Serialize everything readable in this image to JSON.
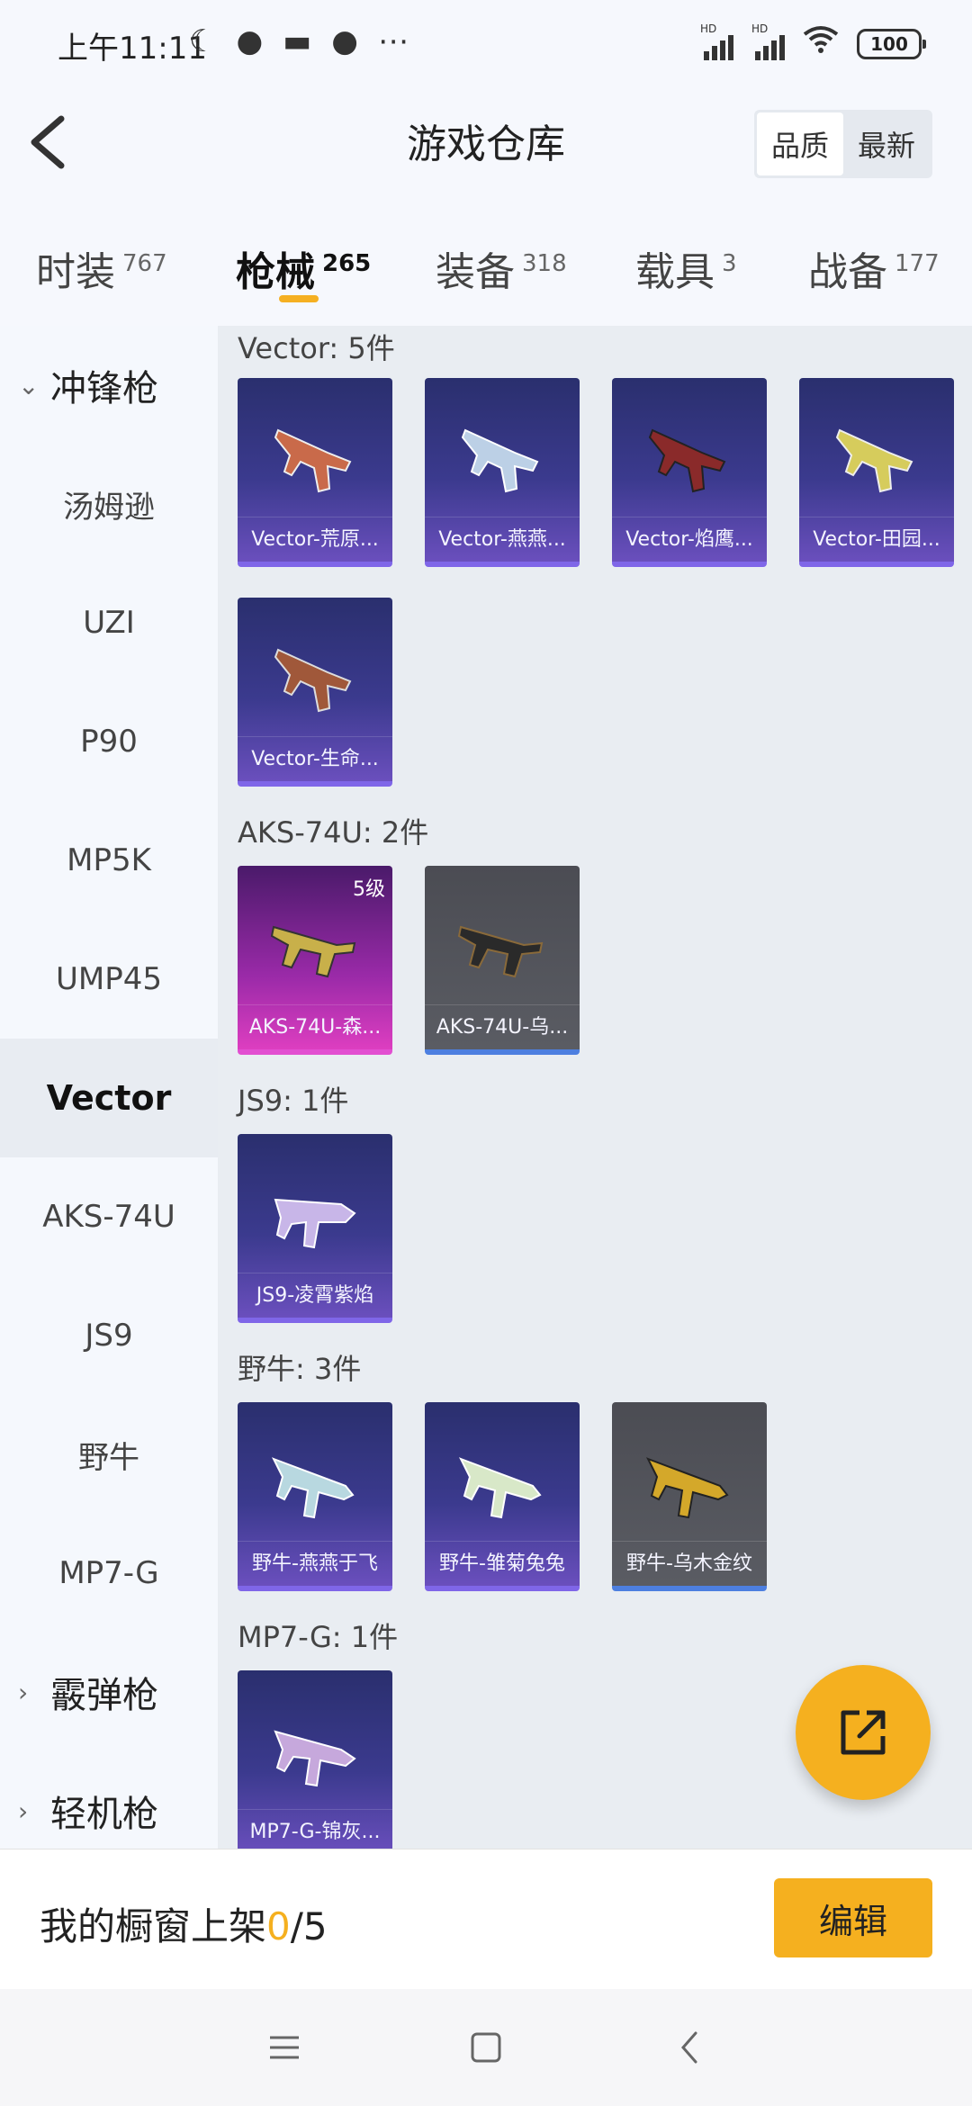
{
  "status_bar": {
    "time": "上午11:11",
    "icons": [
      "moon-icon",
      "wechat-icon",
      "message-icon",
      "wechat-icon",
      "more-icon"
    ],
    "signal_labels": [
      "HD",
      "HD"
    ],
    "battery": "100"
  },
  "header": {
    "title": "游戏仓库",
    "sort_options": [
      "品质",
      "最新"
    ],
    "sort_active": "品质"
  },
  "tabs": [
    {
      "label": "时装",
      "count": "767"
    },
    {
      "label": "枪械",
      "count": "265"
    },
    {
      "label": "装备",
      "count": "318"
    },
    {
      "label": "载具",
      "count": "3"
    },
    {
      "label": "战备",
      "count": "177"
    }
  ],
  "active_tab": "枪械",
  "sidebar": {
    "items": [
      {
        "label": "冲锋枪",
        "type": "category",
        "expanded": true
      },
      {
        "label": "汤姆逊"
      },
      {
        "label": "UZI"
      },
      {
        "label": "P90"
      },
      {
        "label": "MP5K"
      },
      {
        "label": "UMP45"
      },
      {
        "label": "Vector",
        "active": true
      },
      {
        "label": "AKS-74U"
      },
      {
        "label": "JS9"
      },
      {
        "label": "野牛"
      },
      {
        "label": "MP7-G"
      },
      {
        "label": "霰弹枪",
        "type": "category",
        "expanded": false
      },
      {
        "label": "轻机枪",
        "type": "category",
        "expanded": false
      }
    ]
  },
  "groups": [
    {
      "title": "Vector: 5件",
      "items": [
        {
          "name": "Vector-荒原...",
          "rarity": "purple"
        },
        {
          "name": "Vector-燕燕...",
          "rarity": "purple"
        },
        {
          "name": "Vector-焰鹰...",
          "rarity": "purple"
        },
        {
          "name": "Vector-田园...",
          "rarity": "purple"
        },
        {
          "name": "Vector-生命...",
          "rarity": "purple"
        }
      ]
    },
    {
      "title": "AKS-74U: 2件",
      "items": [
        {
          "name": "AKS-74U-森...",
          "rarity": "pink",
          "level": "5级"
        },
        {
          "name": "AKS-74U-乌...",
          "rarity": "gray"
        }
      ]
    },
    {
      "title": "JS9: 1件",
      "items": [
        {
          "name": "JS9-凌霄紫焰",
          "rarity": "purple"
        }
      ]
    },
    {
      "title": "野牛: 3件",
      "items": [
        {
          "name": "野牛-燕燕于飞",
          "rarity": "purple"
        },
        {
          "name": "野牛-雏菊兔兔",
          "rarity": "purple"
        },
        {
          "name": "野牛-乌木金纹",
          "rarity": "gray"
        }
      ]
    },
    {
      "title": "MP7-G: 1件",
      "items": [
        {
          "name": "MP7-G-锦灰...",
          "rarity": "purple"
        }
      ]
    }
  ],
  "showcase": {
    "label": "我的橱窗上架",
    "count": "0",
    "total": "/5",
    "edit_label": "编辑"
  },
  "colors": {
    "accent": "#f5b01f",
    "purple_card": "#3b3a8e",
    "pink_card": "#dd3ec0",
    "gray_card": "#5a5c63"
  }
}
